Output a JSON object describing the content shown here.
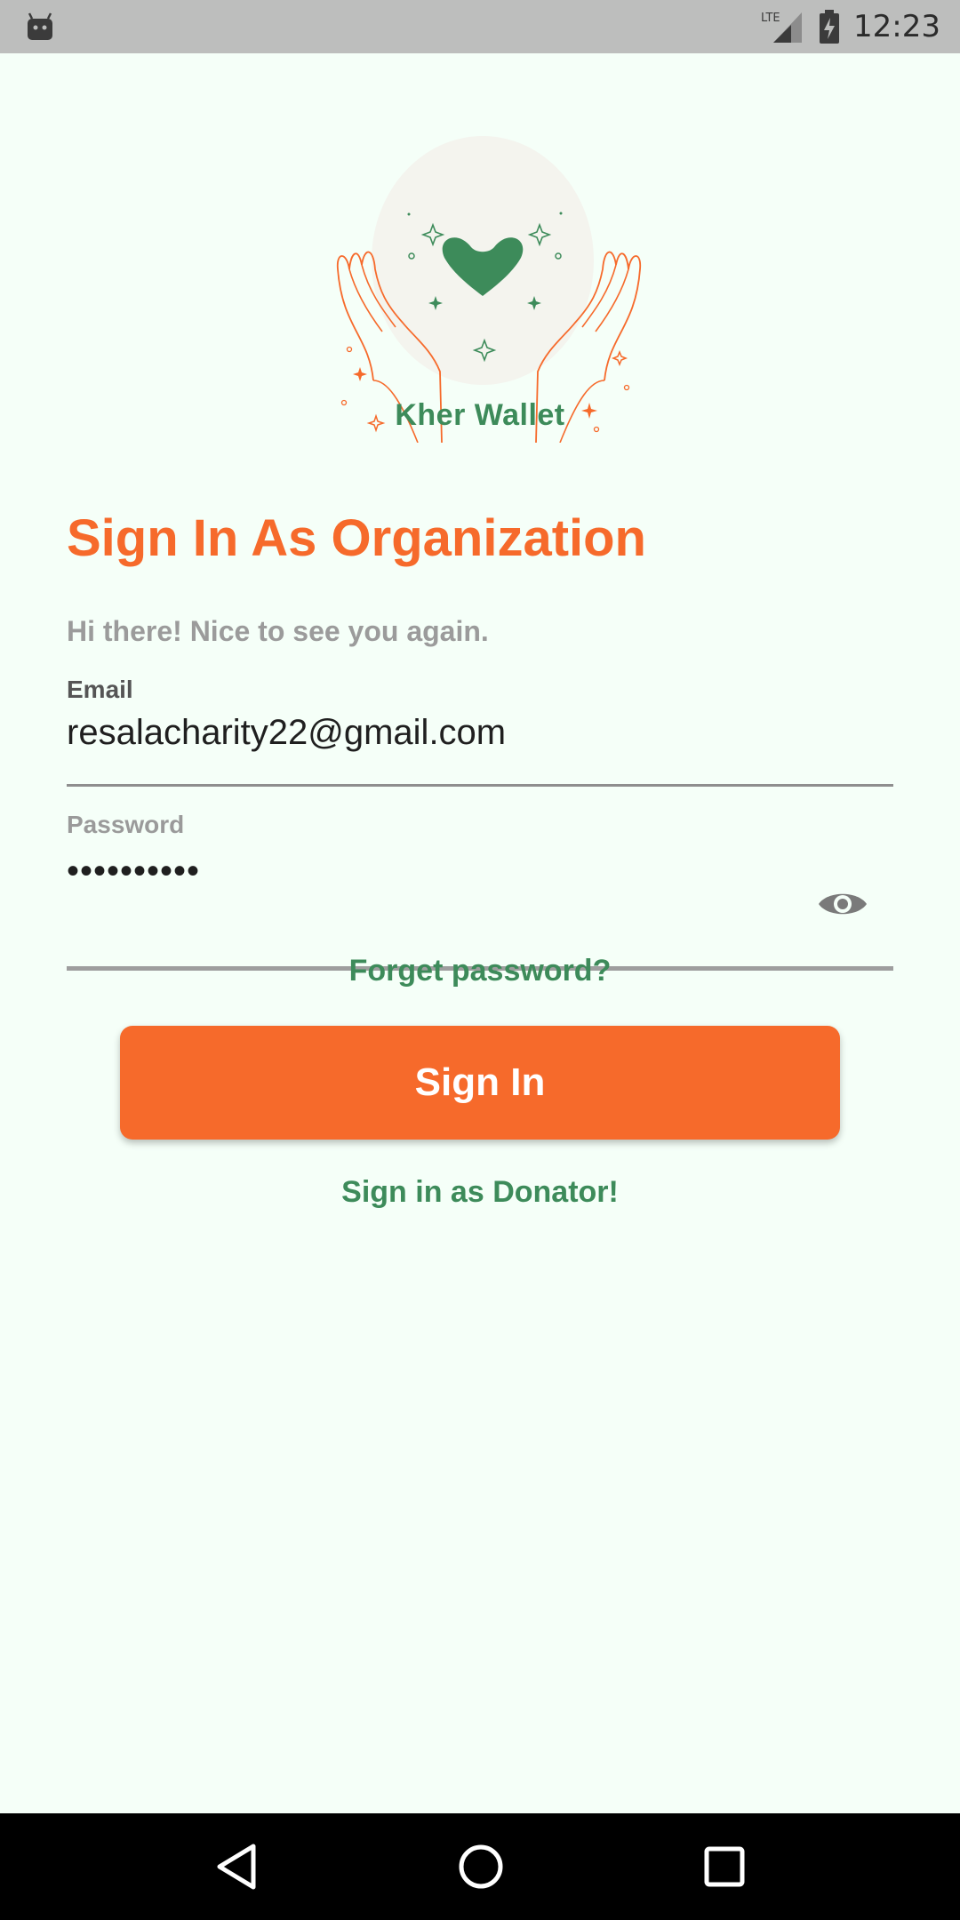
{
  "status_bar": {
    "time": "12:23",
    "network": "LTE",
    "icons": [
      "android-icon",
      "signal-icon",
      "battery-icon"
    ]
  },
  "app": {
    "name": "Kher Wallet"
  },
  "page": {
    "title": "Sign In As Organization",
    "subtitle": "Hi there! Nice to see you again."
  },
  "form": {
    "email_label": "Email",
    "email_value": "resalacharity22@gmail.com",
    "password_label": "Password",
    "password_value": "••••••••••"
  },
  "actions": {
    "forgot_label": "Forget password?",
    "signin_label": "Sign In",
    "donator_label": "Sign in as Donator!"
  },
  "colors": {
    "accent": "#F66A2B",
    "green": "#3D8B5A",
    "background": "#F5FFF8"
  }
}
